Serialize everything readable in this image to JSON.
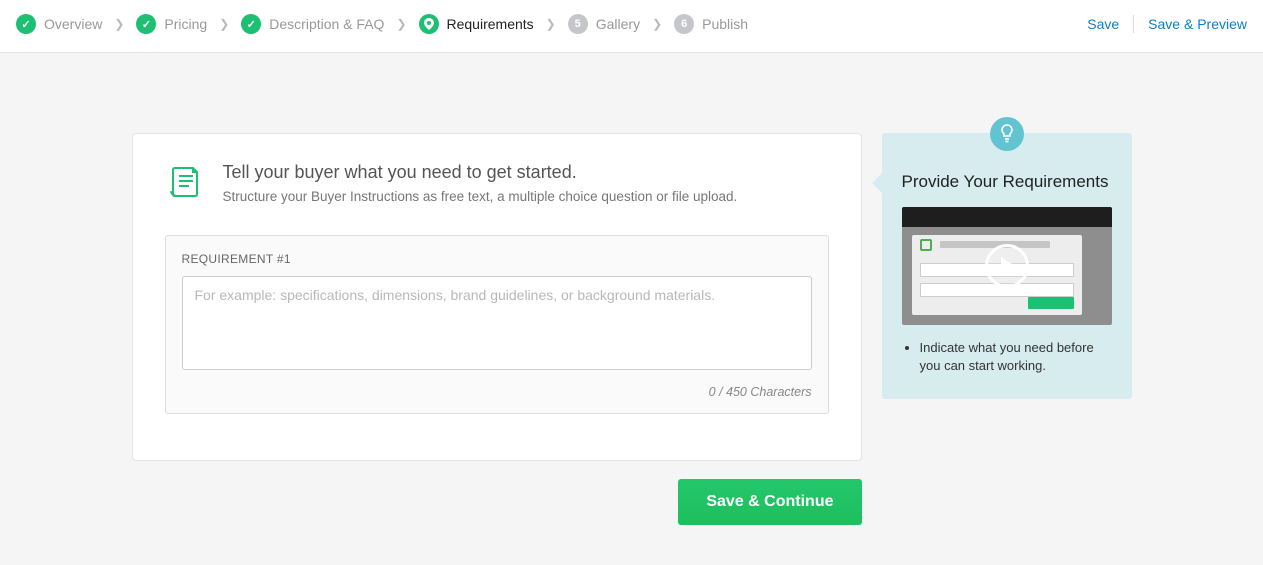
{
  "steps": [
    {
      "label": "Overview",
      "state": "done"
    },
    {
      "label": "Pricing",
      "state": "done"
    },
    {
      "label": "Description & FAQ",
      "state": "done"
    },
    {
      "label": "Requirements",
      "state": "current"
    },
    {
      "label": "Gallery",
      "state": "pending",
      "num": "5"
    },
    {
      "label": "Publish",
      "state": "pending",
      "num": "6"
    }
  ],
  "actions": {
    "save": "Save",
    "savePreview": "Save & Preview"
  },
  "header": {
    "title": "Tell your buyer what you need to get started.",
    "subtitle": "Structure your Buyer Instructions as free text, a multiple choice question or file upload."
  },
  "requirement": {
    "label": "REQUIREMENT #1",
    "placeholder": "For example: specifications, dimensions, brand guidelines, or background materials.",
    "value": "",
    "counter": "0 / 450 Characters"
  },
  "cta": "Save & Continue",
  "sidebar": {
    "title": "Provide Your Requirements",
    "bullet": "Indicate what you need before you can start working."
  }
}
